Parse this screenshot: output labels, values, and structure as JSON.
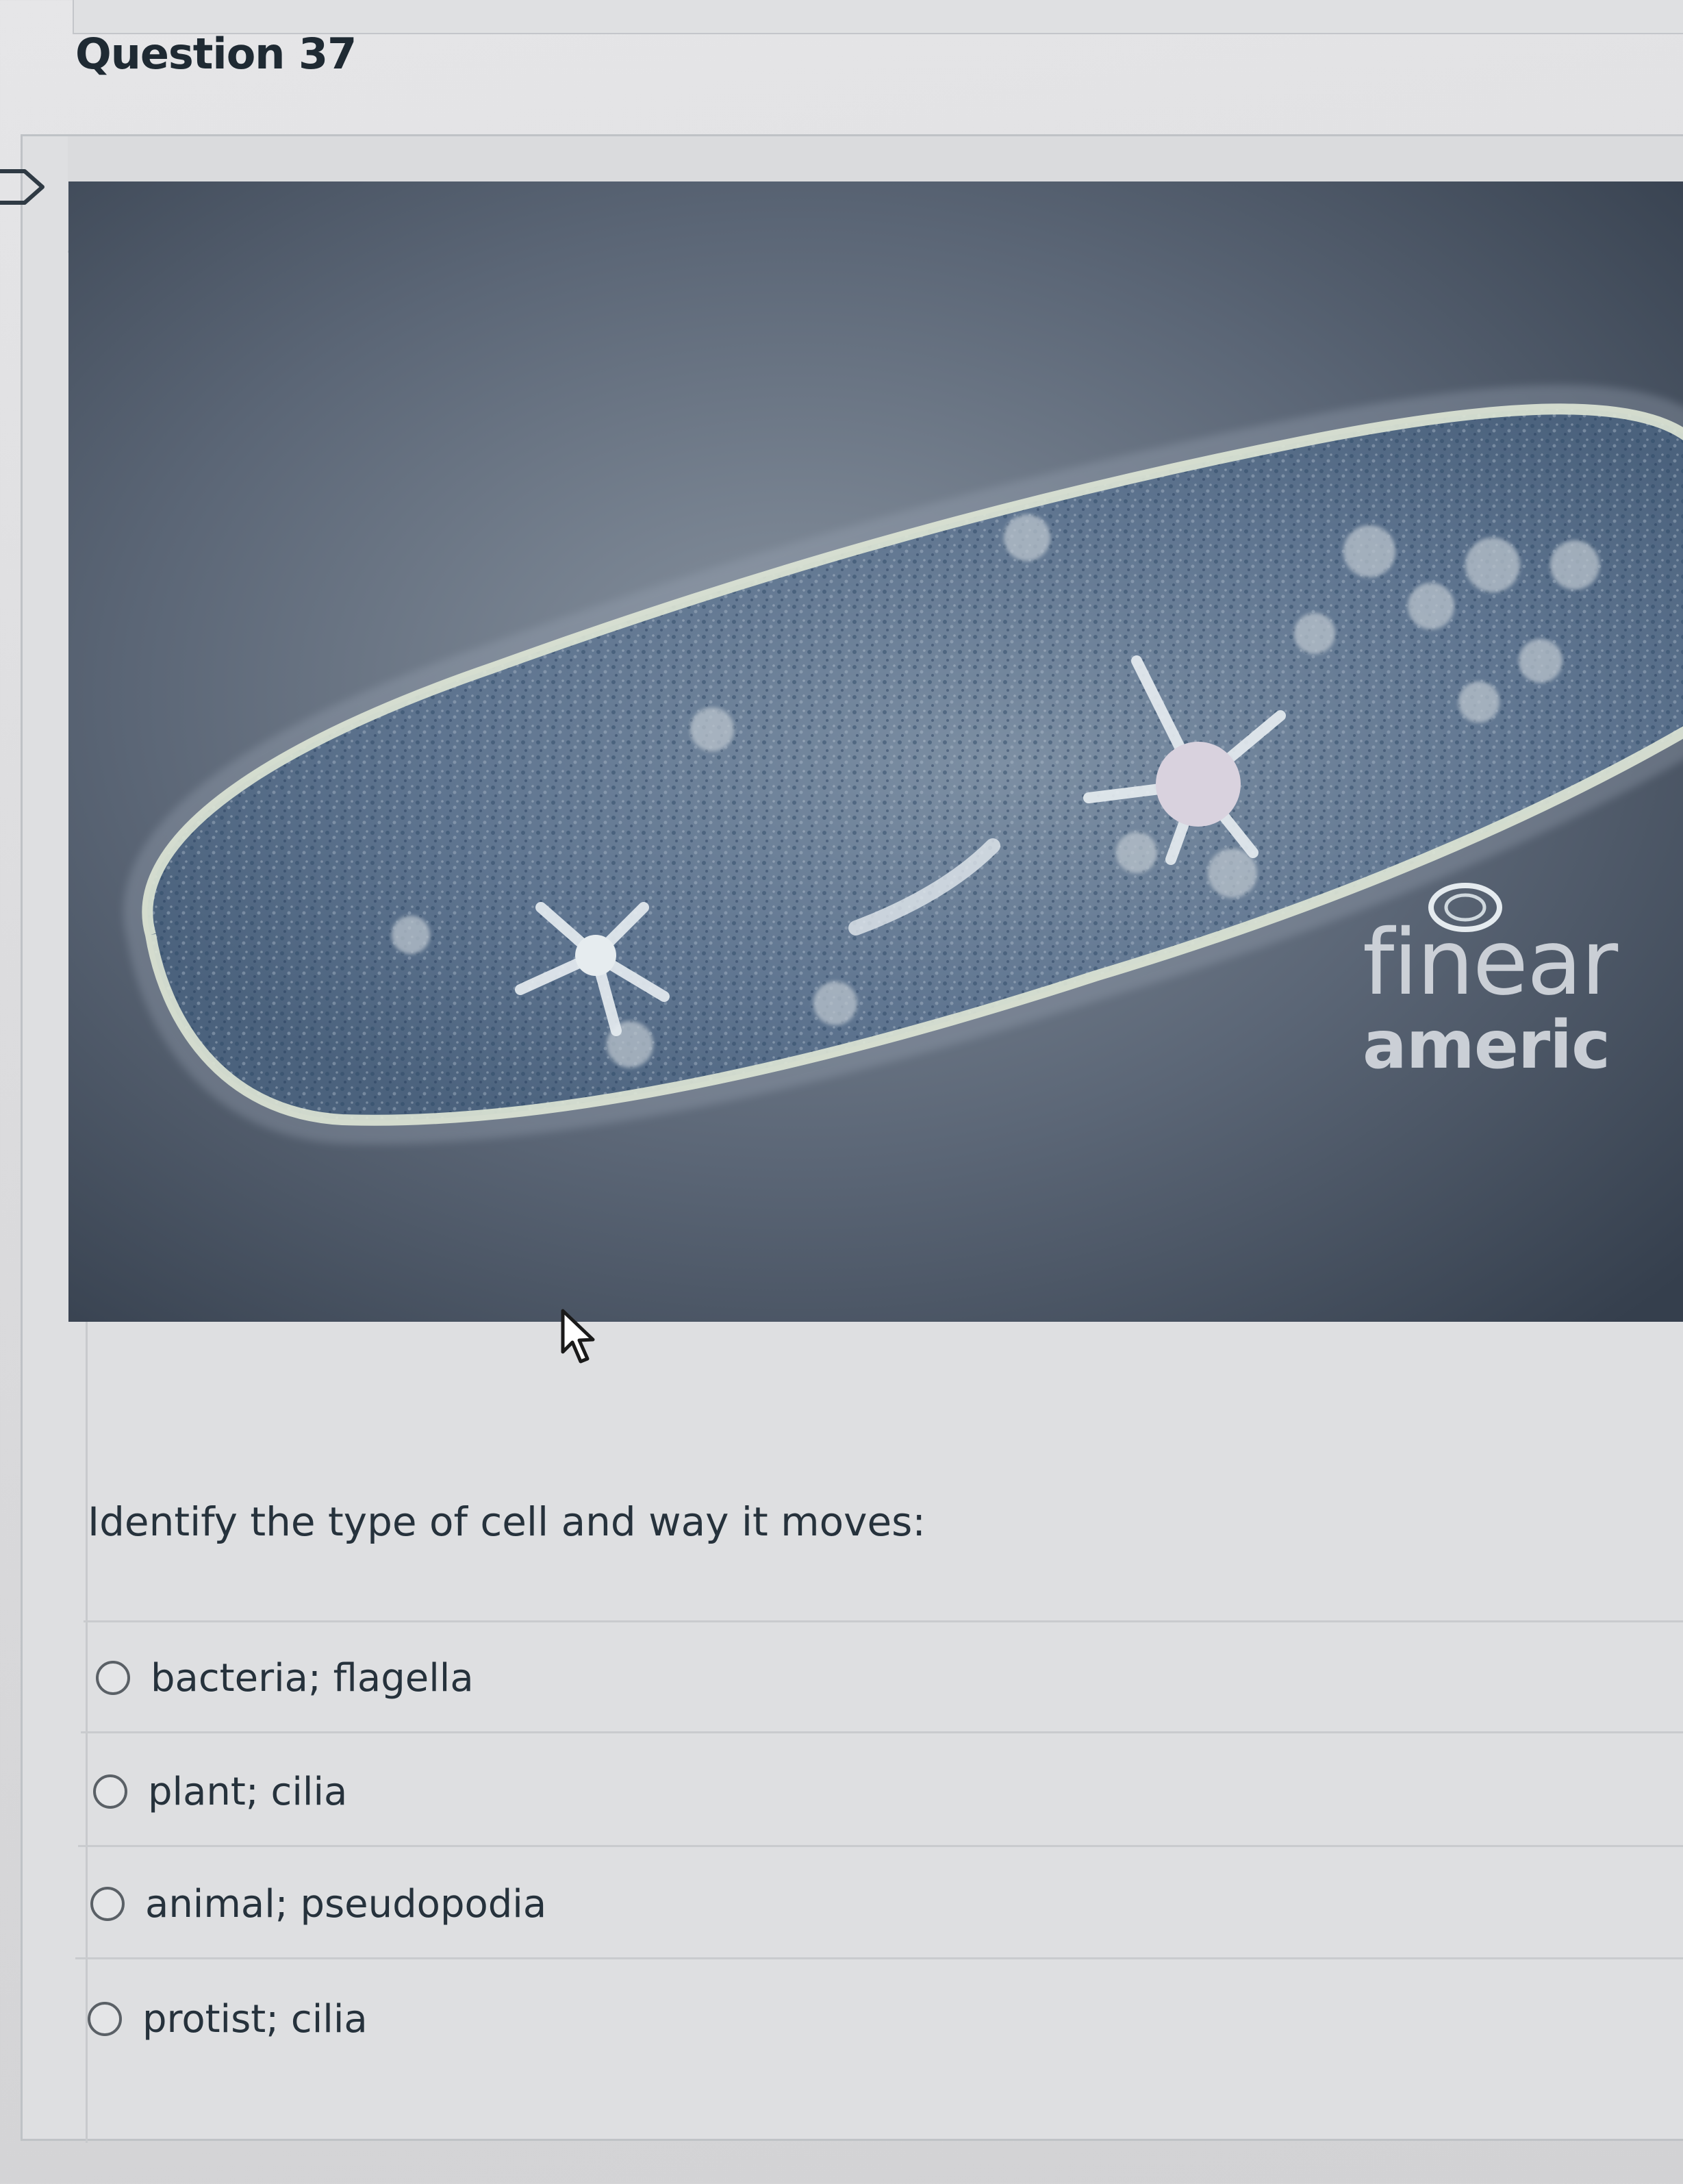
{
  "question": {
    "title": "Question 37",
    "prompt": "Identify the type of cell and way it moves:",
    "image_watermark": [
      "finear",
      "americ"
    ],
    "answers": [
      {
        "label": "bacteria; flagella",
        "selected": false
      },
      {
        "label": "plant; cilia",
        "selected": false
      },
      {
        "label": "animal; pseudopodia",
        "selected": false
      },
      {
        "label": "protist; cilia",
        "selected": false
      }
    ]
  },
  "icons": {
    "bookmark": "bookmark-flag-icon",
    "cursor": "mouse-pointer-icon"
  },
  "colors": {
    "page_background": "#dcdcde",
    "micrograph_background": "#3e4a5a",
    "text": "#26323c"
  }
}
